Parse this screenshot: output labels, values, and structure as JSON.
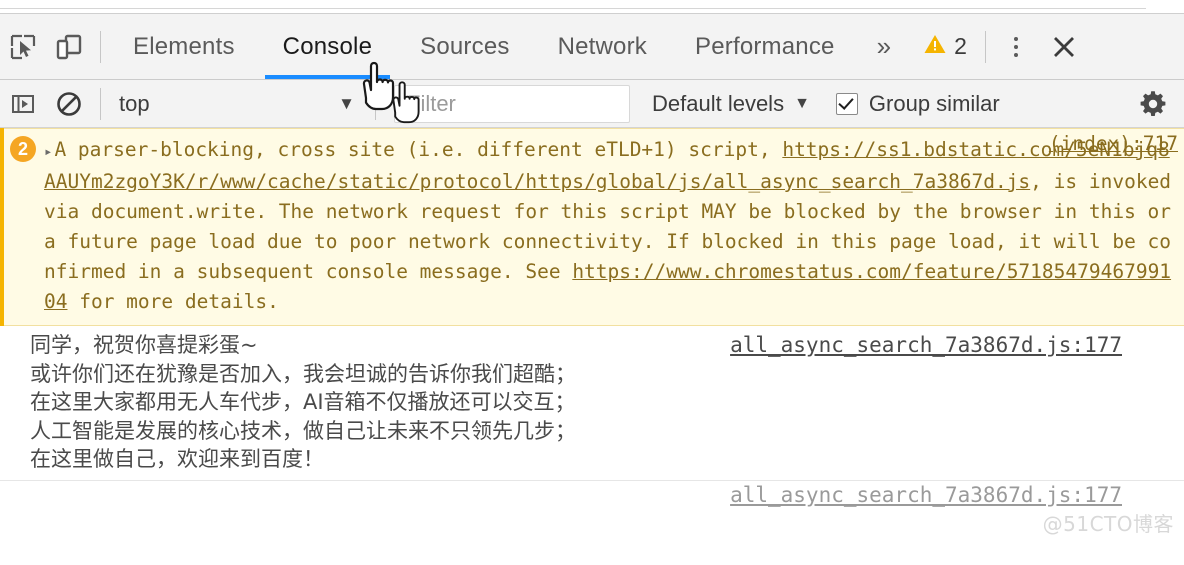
{
  "toolbar": {
    "inspect_icon": "inspect-element-icon",
    "device_icon": "device-toolbar-icon",
    "tabs": [
      {
        "label": "Elements",
        "active": false
      },
      {
        "label": "Console",
        "active": true
      },
      {
        "label": "Sources",
        "active": false
      },
      {
        "label": "Network",
        "active": false
      },
      {
        "label": "Performance",
        "active": false
      }
    ],
    "more_tabs": "»",
    "warning_icon": "warning-triangle-icon",
    "warning_count": "2",
    "kebab_icon": "more-options-icon",
    "close_icon": "close-icon",
    "active_tab_underline_color": "#1a8cff"
  },
  "filterbar": {
    "sidebar_toggle_icon": "console-sidebar-toggle-icon",
    "clear_icon": "clear-console-icon",
    "context": "top",
    "context_caret": "▼",
    "filter_placeholder": "Filter",
    "filter_value": "",
    "levels_label": "Default levels",
    "levels_caret": "▼",
    "group_similar_label": "Group similar",
    "group_similar_checked": true,
    "settings_icon": "gear-icon"
  },
  "console": {
    "warning_entry": {
      "badge_count": "2",
      "disclosure": "▸",
      "badge_color": "#f5a623",
      "background": "#fffbe5",
      "text_color": "#8a6d1f",
      "segment_1": "A parser-blocking, cross site (i.e. different eTLD+1) script, ",
      "link_url": "https://ss1.bdstatic.com/5eN1bjq8AAUYm2zgoY3K/r/www/cache/static/protocol/https/global/js/all_async_search_7a3867d.js",
      "segment_2": ", is invoked via document.write. The network request for this script MAY be blocked by the browser in this or a future page load due to poor network connectivity. If blocked in this page load, it will be confirmed in a subsequent console message. See ",
      "link_url_2": "https://www.chromestatus.com/feature/5718547946799104",
      "segment_3": " for more details.",
      "source_link": "(index):717"
    },
    "log_entry": {
      "lines": [
        "同学，祝贺你喜提彩蛋~",
        "或许你们还在犹豫是否加入，我会坦诚的告诉你我们超酷；",
        "在这里大家都用无人车代步，AI音箱不仅播放还可以交互；",
        "人工智能是发展的核心技术，做自己让未来不只领先几步；",
        "在这里做自己，欢迎来到百度！"
      ],
      "source_link": "all_async_search_7a3867d.js:177"
    },
    "next_entry": {
      "source_link": "all_async_search_7a3867d.js:177"
    }
  },
  "watermark": "@51CTO博客"
}
